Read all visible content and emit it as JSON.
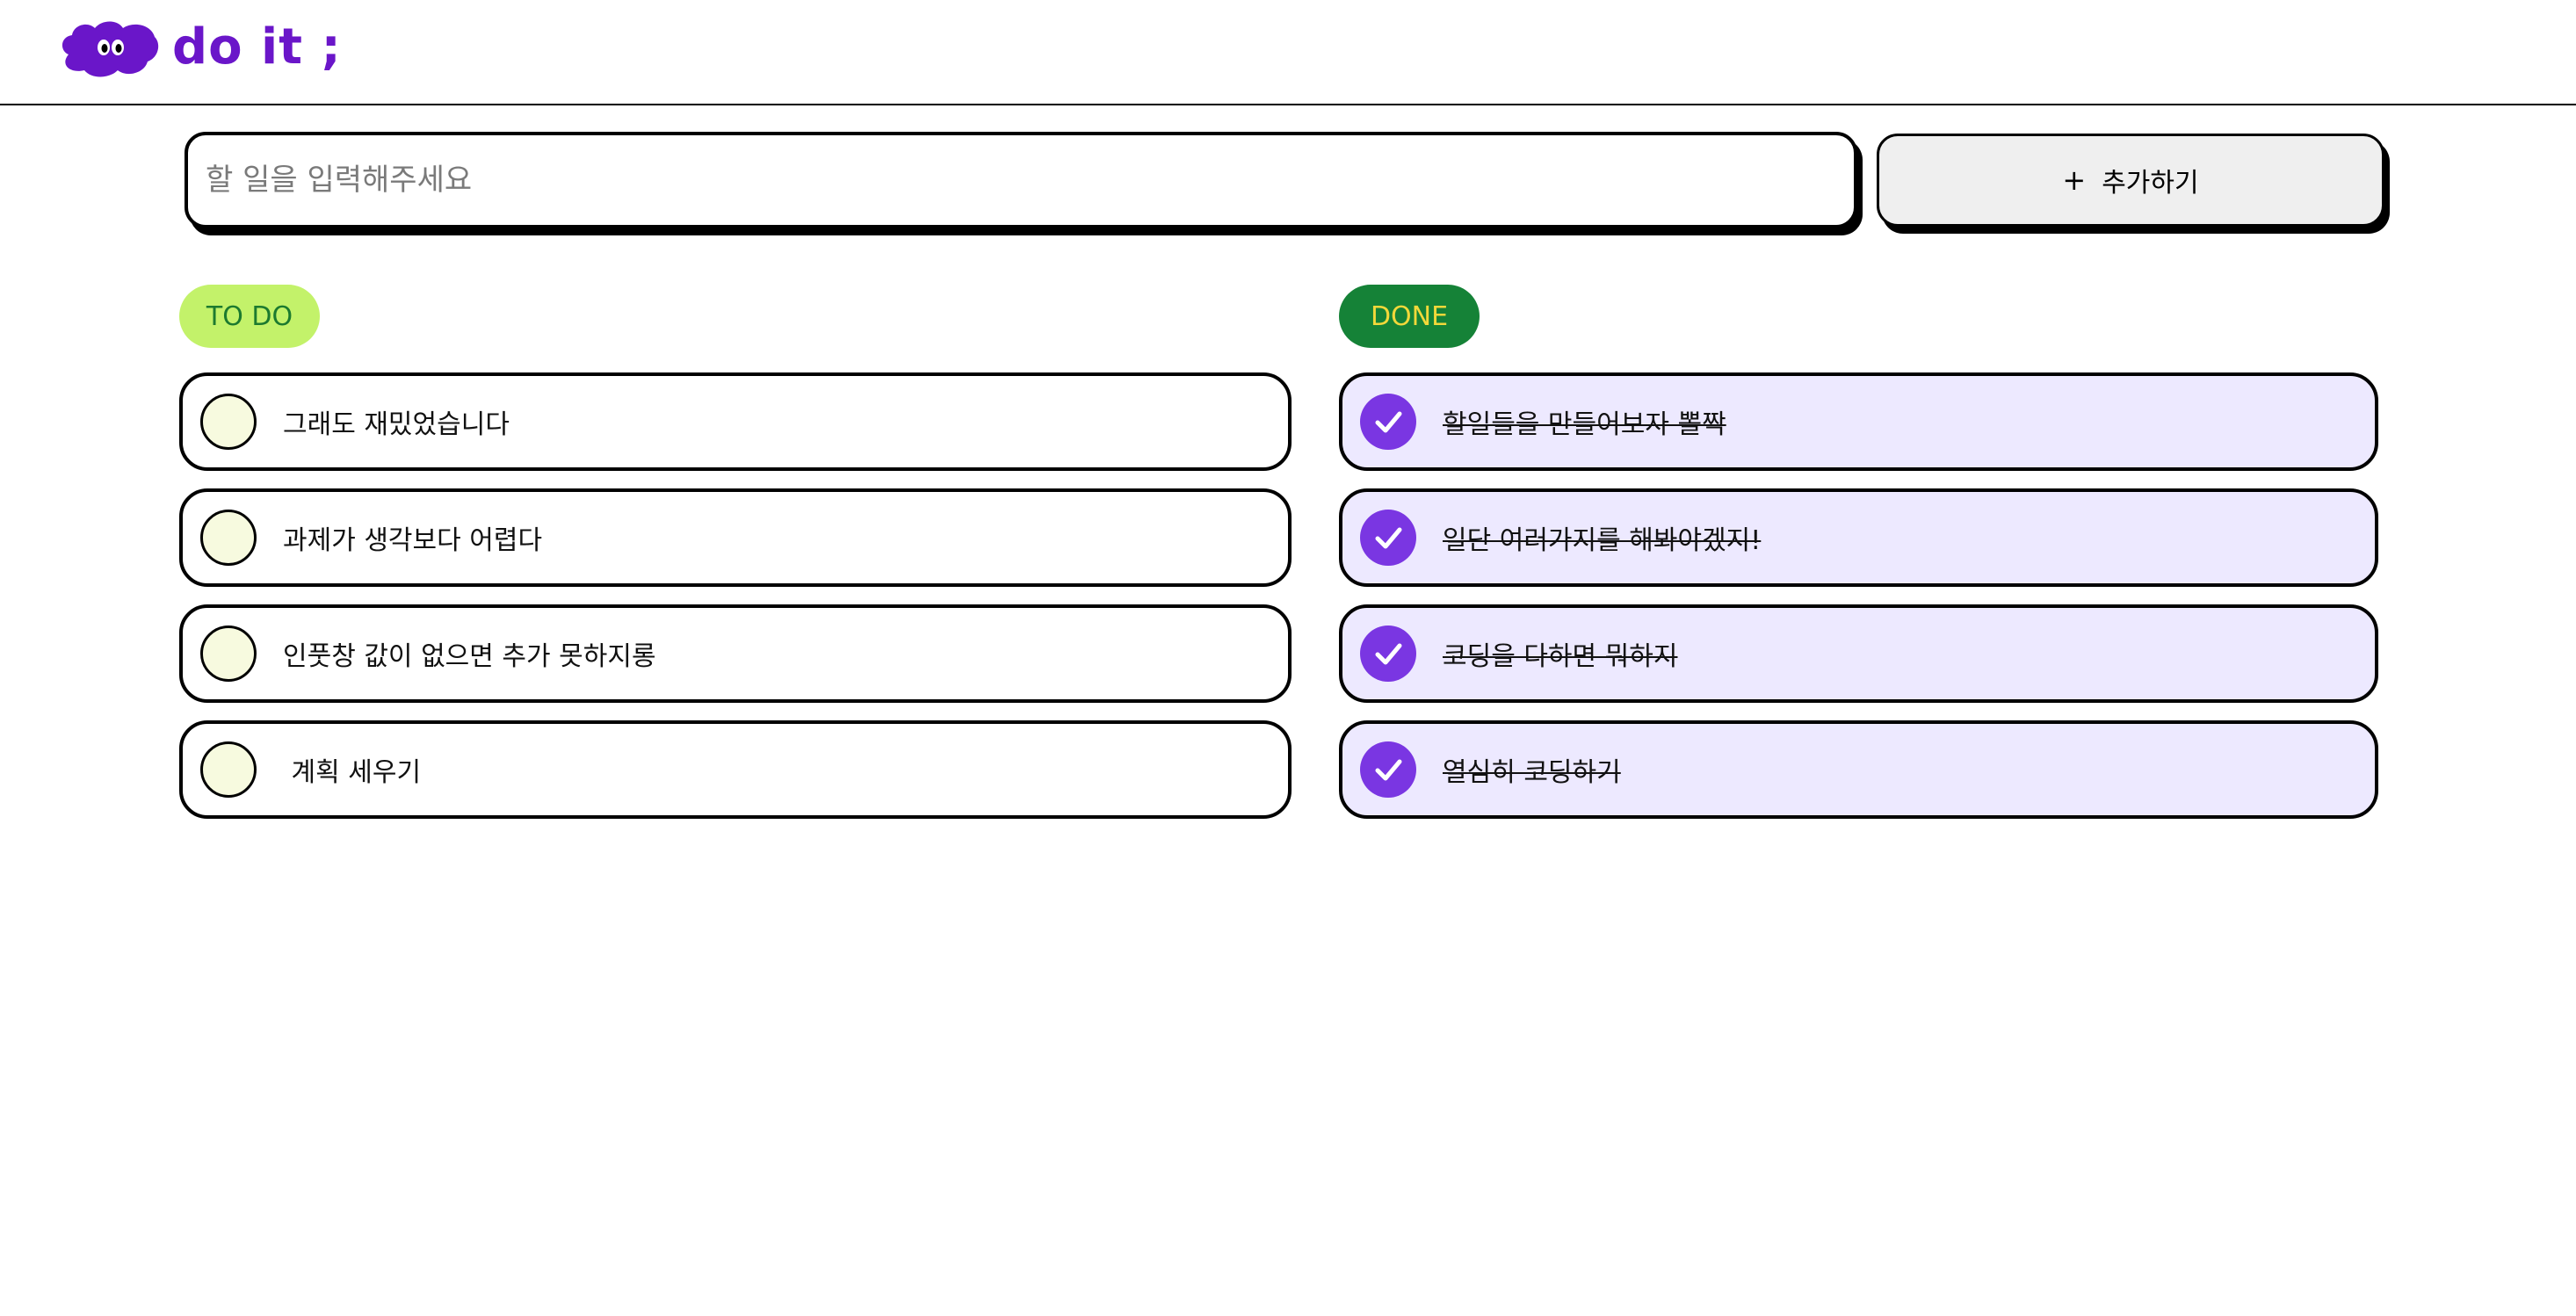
{
  "app": {
    "logo_text": "do it ;",
    "brand_color": "#6a16c9"
  },
  "input": {
    "placeholder": "할 일을 입력해주세요",
    "value": ""
  },
  "add_button": {
    "icon": "plus-icon",
    "label": "추가하기"
  },
  "todo": {
    "badge": "TO DO",
    "badge_bg": "#c3f26a",
    "badge_fg": "#1c7a2f",
    "items": [
      {
        "label": "그래도 재밌었습니다",
        "done": false
      },
      {
        "label": "과제가 생각보다 어렵다",
        "done": false
      },
      {
        "label": "인풋창 값이 없으면 추가 못하지롱",
        "done": false
      },
      {
        "label": " 계획 세우기",
        "done": false
      }
    ]
  },
  "done": {
    "badge": "DONE",
    "badge_bg": "#158237",
    "badge_fg": "#f2d83a",
    "items": [
      {
        "label": "할일들을 만들어보자 뽈짝",
        "done": true
      },
      {
        "label": "일단 여러가지를 해봐야겠지!",
        "done": true
      },
      {
        "label": "코딩을 다하면 뭐하지",
        "done": true
      },
      {
        "label": "열심히 코딩하기",
        "done": true
      }
    ],
    "check_color": "#7a36e2",
    "row_bg": "#ede9ff"
  }
}
